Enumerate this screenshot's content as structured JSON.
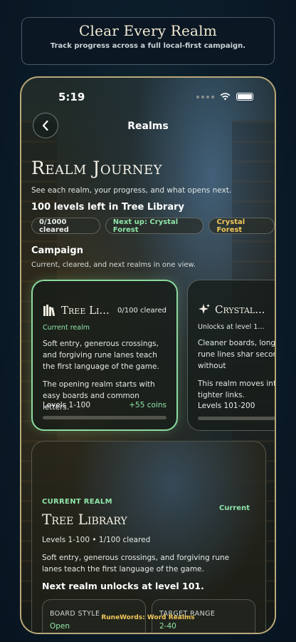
{
  "banner": {
    "title": "Clear Every Realm",
    "subtitle": "Track progress across a full local-first campaign."
  },
  "status_bar": {
    "time": "5:19",
    "icons": [
      "signal-dots-icon",
      "wifi-icon",
      "battery-icon"
    ]
  },
  "nav": {
    "title": "Realms",
    "back_icon": "chevron-left-icon"
  },
  "hero": {
    "title": "Realm Journey",
    "subtitle": "See each realm, your progress, and what opens next.",
    "levels_left": "100 levels left in Tree Library",
    "chips": {
      "cleared": "0/1000 cleared",
      "next_up": "Next up: Crystal Forest",
      "realm": "Crystal Forest"
    }
  },
  "campaign": {
    "title": "Campaign",
    "subtitle": "Current, cleared, and next realms in one view.",
    "cards": [
      {
        "icon": "book-stack-icon",
        "name": "Tree Li...",
        "count": "0/100 cleared",
        "status": "Current realm",
        "text1": "Soft entry, generous crossings, and forgiving rune lanes teach the first language of the game.",
        "text2": "The opening realm starts with easy boards and common letters.",
        "levels": "Levels 1-100",
        "reward": "+55 coins"
      },
      {
        "icon": "sparkle-icon",
        "name": "Crystal...",
        "status": "Unlocks at level 1...",
        "text1": "Cleaner boards, longer brighter rune lines shar second stretch without",
        "text2": "This realm moves into and tighter links.",
        "levels": "Levels 101-200"
      }
    ]
  },
  "detail": {
    "eyebrow": "CURRENT REALM",
    "badge": "Current",
    "title": "Tree Library",
    "meta": "Levels 1-100 • 1/100 cleared",
    "description": "Soft entry, generous crossings, and forgiving rune lanes teach the first language of the game.",
    "unlock": "Next realm unlocks at level 101.",
    "stats": [
      {
        "label": "BOARD STYLE",
        "value": "Open"
      },
      {
        "label": "TARGET RANGE",
        "value": "2-40"
      }
    ]
  },
  "footer": {
    "label": "RuneWords: Word Realms"
  },
  "colors": {
    "accent_green": "#8fe4a8",
    "accent_gold": "#f0c85a",
    "frame_gold": "#b9a878"
  }
}
